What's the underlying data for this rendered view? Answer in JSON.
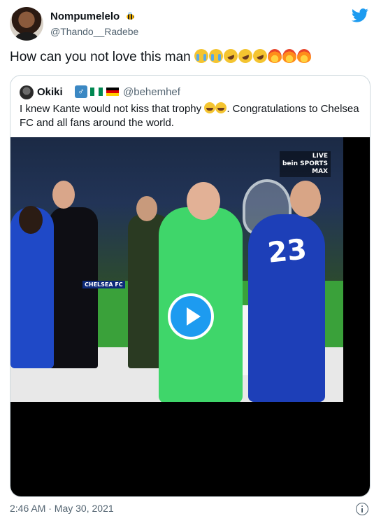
{
  "tweet": {
    "author": {
      "display_name": "Nompumelelo",
      "handle": "@Thando__Radebe"
    },
    "text": "How can you not love this man",
    "emojis": [
      "loudly-crying-face",
      "loudly-crying-face",
      "rolling-on-floor-laughing",
      "rolling-on-floor-laughing",
      "rolling-on-floor-laughing",
      "fire",
      "fire",
      "fire"
    ],
    "timestamp": "2:46 AM · May 30, 2021"
  },
  "quoted_tweet": {
    "author": {
      "display_name": "Okiki",
      "handle": "@behemhef"
    },
    "text_part1": "I knew Kante would not kiss that trophy",
    "text_part2": ". Congratulations to Chelsea FC and all fans around the world.",
    "video": {
      "broadcaster": "bein SPORTS",
      "live_label": "LIVE",
      "max_label": "MAX",
      "banner": "CHELSEA FC",
      "jersey_number": "23"
    }
  },
  "colors": {
    "accent": "#1d9bf0",
    "text": "#0f1419",
    "secondary": "#536471",
    "border": "#cfd9de"
  },
  "icons": {
    "brand": "twitter-bird-icon",
    "info": "info-icon",
    "play": "play-icon"
  }
}
